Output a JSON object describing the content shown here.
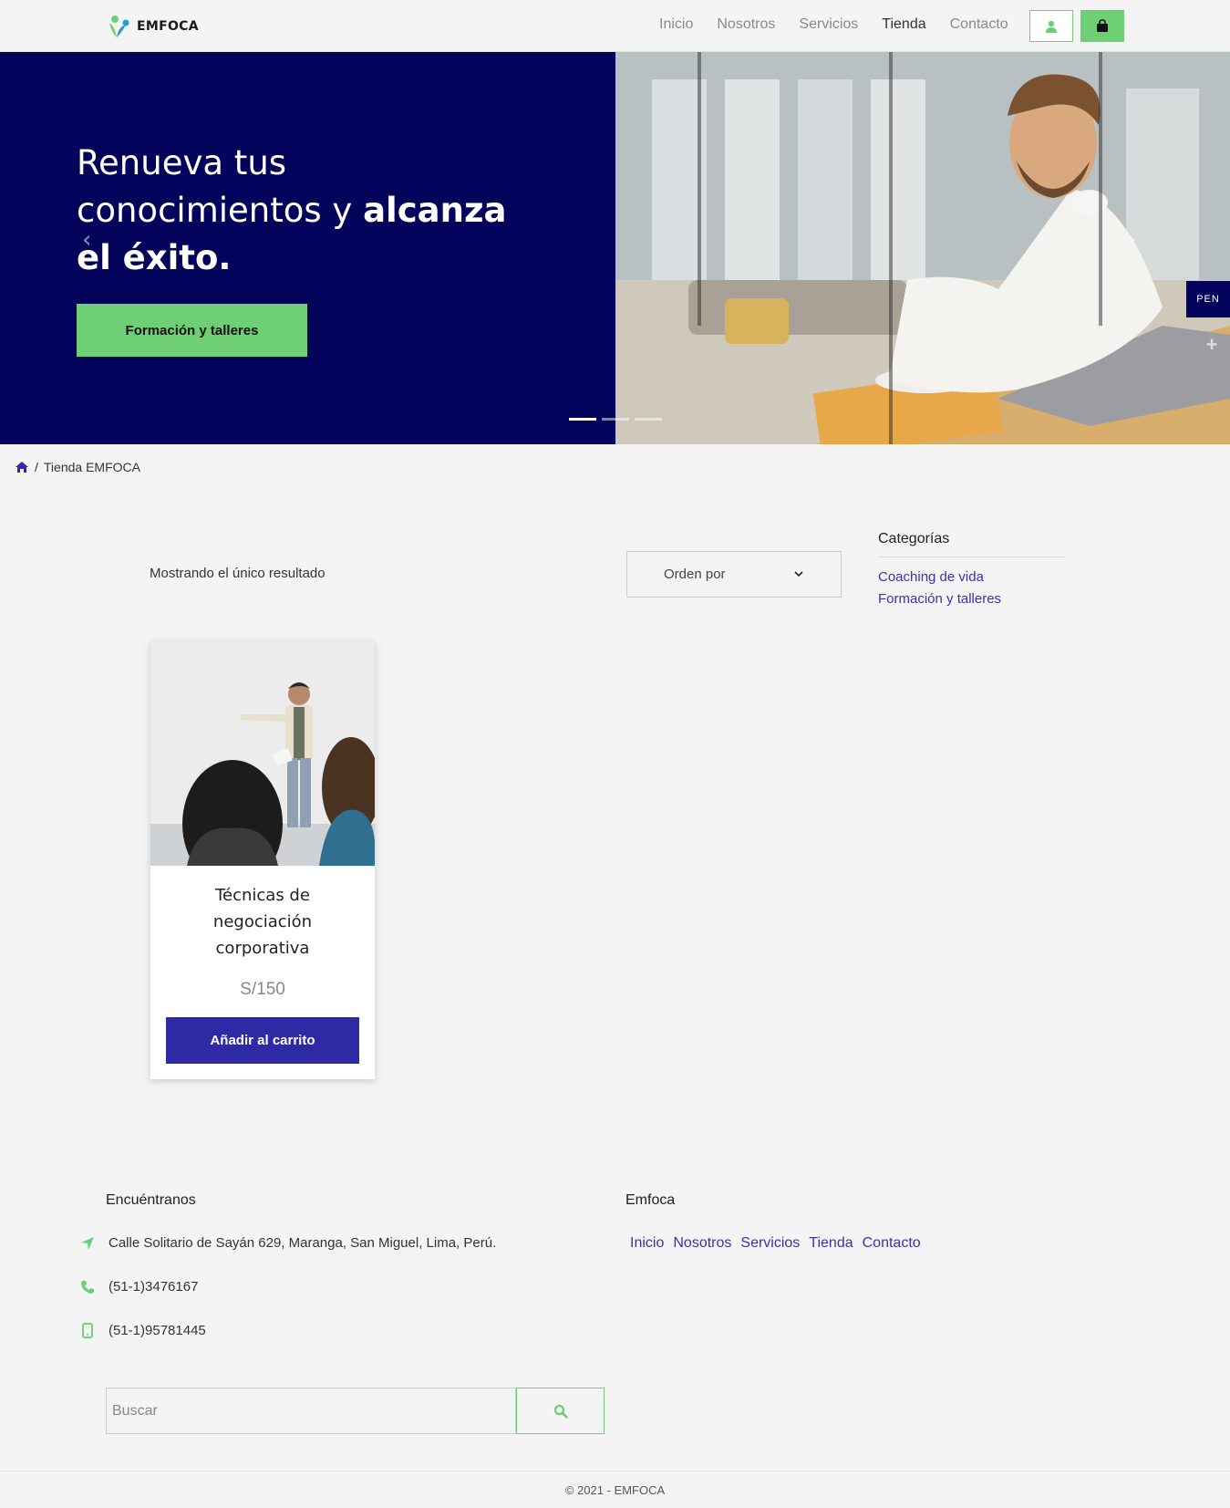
{
  "header": {
    "brand": "EMFOCA",
    "nav": [
      "Inicio",
      "Nosotros",
      "Servicios",
      "Tienda",
      "Contacto"
    ],
    "active_nav": "Tienda",
    "user_icon": "user-icon",
    "cart_icon": "shopping-bag-icon"
  },
  "hero": {
    "title_plain": "Renueva tus conocimientos y ",
    "title_bold": "alcanza el éxito.",
    "cta": "Formación y talleres",
    "slides": 3,
    "active_slide": 1
  },
  "floating": {
    "currency": "PEN",
    "plus": "+"
  },
  "breadcrumb": {
    "home_icon": "home-icon",
    "separator": "/",
    "current": "Tienda EMFOCA"
  },
  "shop": {
    "result_count": "Mostrando el único resultado",
    "orderby": "Orden por",
    "products": [
      {
        "title": "Técnicas de negociación corporativa",
        "price": "S/150",
        "button": "Añadir al carrito"
      }
    ]
  },
  "sidebar": {
    "title": "Categorías",
    "categories": [
      "Coaching de vida",
      "Formación y talleres"
    ]
  },
  "footer": {
    "find_us_title": "Encuéntranos",
    "address": "Calle Solitario de Sayán 629, Maranga, San Miguel, Lima, Perú.",
    "phone": "(51-1)3476167",
    "mobile": "(51-1)95781445",
    "links_title": "Emfoca",
    "links": [
      "Inicio",
      "Nosotros",
      "Servicios",
      "Tienda",
      "Contacto"
    ],
    "search_placeholder": "Buscar",
    "copyright": "© 2021 - EMFOCA"
  },
  "colors": {
    "brand_green": "#6fcf74",
    "brand_navy": "#03035b",
    "accent_blue": "#2e2aa6",
    "link_blue": "#3b33a6"
  }
}
